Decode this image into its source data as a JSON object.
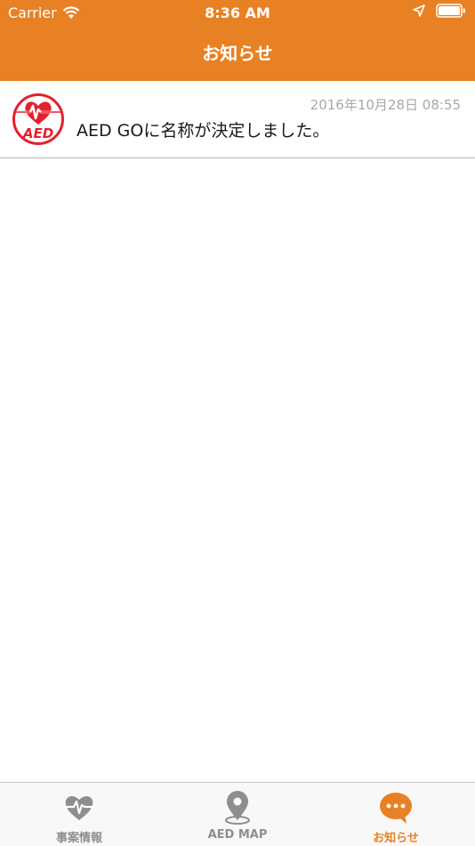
{
  "status_bar": {
    "carrier": "Carrier",
    "time": "8:36 AM",
    "wifi_icon": "wifi-icon",
    "location_icon": "location-arrow-icon",
    "battery_icon": "battery-icon"
  },
  "nav": {
    "title": "お知らせ"
  },
  "news": [
    {
      "logo_text": "AED",
      "date": "2016年10月28日 08:55",
      "title": "AED GOに名称が決定しました。"
    }
  ],
  "tabbar": {
    "tabs": [
      {
        "label": "事案情報",
        "icon": "heart-pulse-icon",
        "active": false
      },
      {
        "label": "AED MAP",
        "icon": "map-pin-icon",
        "active": false
      },
      {
        "label": "お知らせ",
        "icon": "chat-bubble-icon",
        "active": true
      }
    ]
  },
  "colors": {
    "accent": "#e88124",
    "logo_red": "#e4202e",
    "tab_inactive": "#8e8e8e",
    "date_gray": "#a8a8a8"
  }
}
